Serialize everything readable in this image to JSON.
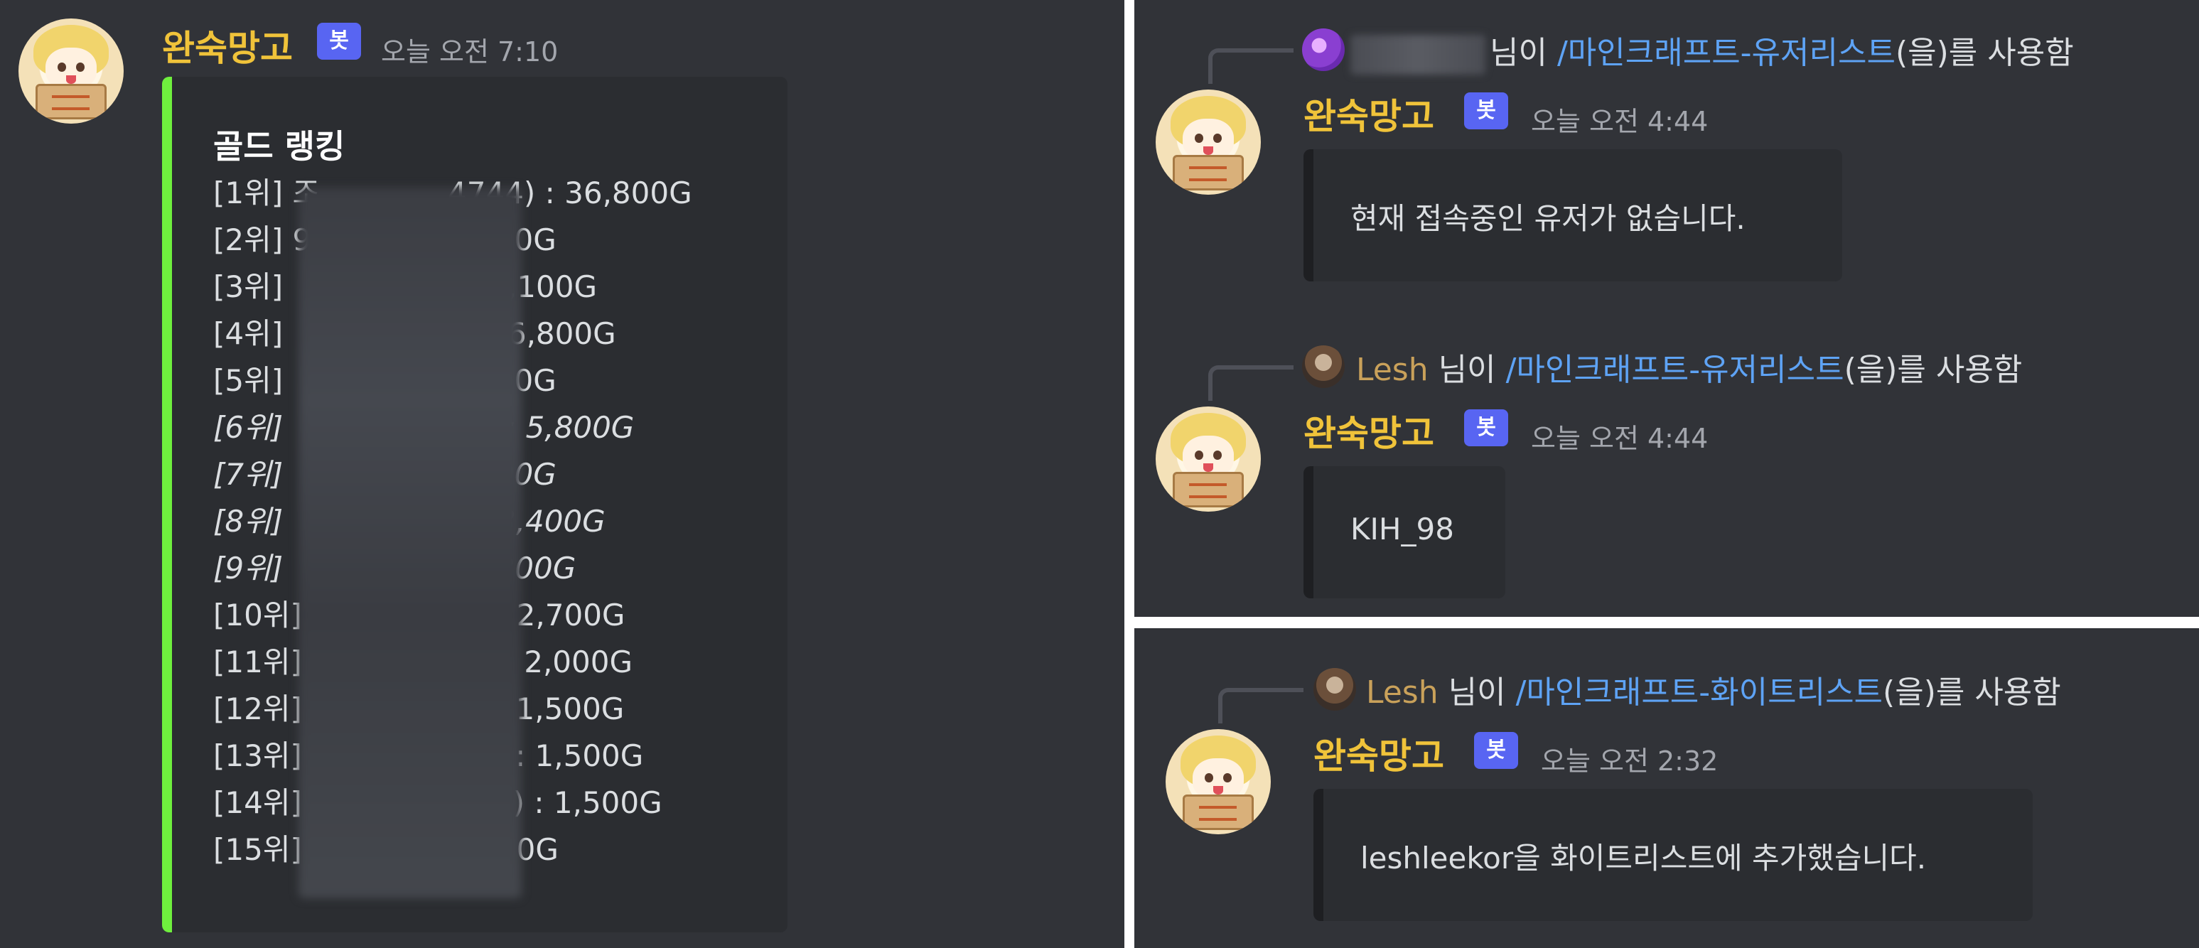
{
  "left": {
    "author": "완숙망고",
    "bot_tag": "봇",
    "timestamp": "오늘 오전 7:10",
    "embed_title": "골드 랭킹",
    "accent_color": "#6fef3e",
    "ranks": [
      {
        "prefix": "[1위] 조",
        "suffix": "4744) : 36,800G"
      },
      {
        "prefix": "[2위] 9",
        "suffix": "7,800G"
      },
      {
        "prefix": "[3위] ",
        "suffix": ") : 7,100G"
      },
      {
        "prefix": "[4위] ",
        "suffix": "n) : 6,800G"
      },
      {
        "prefix": "[5위] ",
        "suffix": "6,300G"
      },
      {
        "prefix": "[6위] ",
        "suffix": "on) : 5,800G"
      },
      {
        "prefix": "[7위] ",
        "suffix": "4,900G"
      },
      {
        "prefix": "[8위] ",
        "suffix": "l) : 3,400G"
      },
      {
        "prefix": "[9위] ",
        "suffix": ": 3,200G"
      },
      {
        "prefix": "[10위]",
        "suffix": "98) : 2,700G"
      },
      {
        "prefix": "[11위]",
        "suffix": "nol) : 2,000G"
      },
      {
        "prefix": "[12위]",
        "suffix": "on) : 1,500G"
      },
      {
        "prefix": "[13위]",
        "suffix": "e02) : 1,500G"
      },
      {
        "prefix": "[14위]",
        "suffix": "gong) : 1,500G"
      },
      {
        "prefix": "[15위]",
        "suffix": "04) : 0G"
      }
    ]
  },
  "right_top": {
    "msg1": {
      "reply_suffix": "님이",
      "reply_cmd": "/마인크래프트-유저리스트",
      "reply_tail": "(을)를 사용함",
      "author": "완숙망고",
      "bot_tag": "봇",
      "timestamp": "오늘 오전 4:44",
      "text": "현재 접속중인 유저가 없습니다."
    },
    "msg2": {
      "reply_user": "Lesh",
      "reply_suffix": " 님이",
      "reply_cmd": "/마인크래프트-유저리스트",
      "reply_tail": "(을)를 사용함",
      "author": "완숙망고",
      "bot_tag": "봇",
      "timestamp": "오늘 오전 4:44",
      "text": "KIH_98"
    }
  },
  "right_bottom": {
    "reply_user": "Lesh",
    "reply_suffix": " 님이",
    "reply_cmd": "/마인크래프트-화이트리스트",
    "reply_tail": "(을)를 사용함",
    "author": "완숙망고",
    "bot_tag": "봇",
    "timestamp": "오늘 오전 2:32",
    "text": "leshleekor을 화이트리스트에 추가했습니다."
  }
}
